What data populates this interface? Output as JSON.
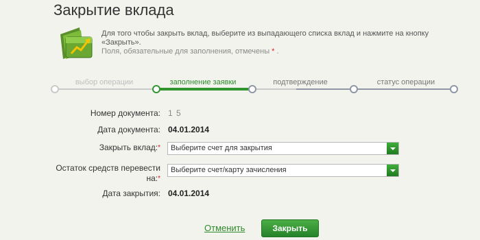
{
  "page": {
    "title": "Закрытие вклада",
    "info_text": "Для того чтобы закрыть вклад, выберите из выпадающего списка вклад и нажмите на кнопку «Закрыть».",
    "required_hint": "Поля, обязательные для заполнения, отмечены",
    "required_mark": "*",
    "required_suffix": "."
  },
  "steps": [
    {
      "label": "выбор операции",
      "state": "done"
    },
    {
      "label": "заполнение заявки",
      "state": "active"
    },
    {
      "label": "подтверждение",
      "state": "pending"
    },
    {
      "label": "статус операции",
      "state": "pending"
    }
  ],
  "form": {
    "doc_number_label": "Номер документа:",
    "doc_number_value": "1   5",
    "doc_date_label": "Дата документа:",
    "doc_date_value": "04.01.2014",
    "close_deposit_label": "Закрыть вклад:",
    "close_deposit_placeholder": "Выберите счет для закрытия",
    "transfer_label_line1": "Остаток средств перевести",
    "transfer_label_line2": "на:",
    "transfer_placeholder": "Выберите счет/карту зачисления",
    "close_date_label": "Дата закрытия:",
    "close_date_value": "04.01.2014",
    "required_mark": "*"
  },
  "actions": {
    "cancel_label": "Отменить",
    "close_label": "Закрыть"
  },
  "colors": {
    "accent_green": "#30942f",
    "required_red": "#d02020",
    "background": "#f3f3ee"
  }
}
